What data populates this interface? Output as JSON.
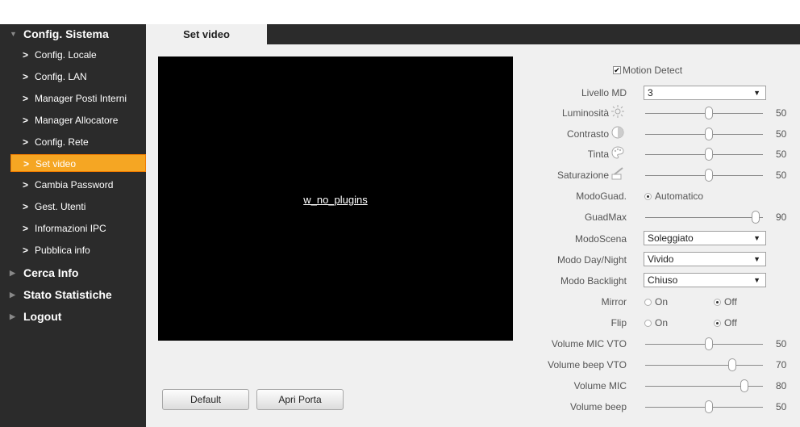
{
  "sidebar": {
    "sections": [
      {
        "label": "Config. Sistema",
        "expanded": true
      },
      {
        "label": "Cerca Info"
      },
      {
        "label": "Stato Statistiche"
      },
      {
        "label": "Logout"
      }
    ],
    "items": [
      {
        "label": "Config. Locale"
      },
      {
        "label": "Config. LAN"
      },
      {
        "label": "Manager Posti Interni"
      },
      {
        "label": "Manager Allocatore"
      },
      {
        "label": "Config. Rete"
      },
      {
        "label": "Set video",
        "active": true
      },
      {
        "label": "Cambia Password"
      },
      {
        "label": "Gest. Utenti"
      },
      {
        "label": "Informazioni IPC"
      },
      {
        "label": "Pubblica info"
      }
    ],
    "chevron": ">"
  },
  "tab": {
    "label": "Set video"
  },
  "video": {
    "link": "w_no_plugins"
  },
  "buttons": {
    "default": "Default",
    "open_door": "Apri Porta"
  },
  "settings": {
    "motion_detect": {
      "label": "Motion Detect",
      "checked": true
    },
    "md_level": {
      "label": "Livello MD",
      "value": "3"
    },
    "brightness": {
      "label": "Luminosità",
      "value": "50",
      "icon": "sun-icon"
    },
    "contrast": {
      "label": "Contrasto",
      "value": "50",
      "icon": "contrast-icon"
    },
    "hue": {
      "label": "Tinta",
      "value": "50",
      "icon": "palette-icon"
    },
    "saturation": {
      "label": "Saturazione",
      "value": "50",
      "icon": "saturation-icon"
    },
    "gain_mode": {
      "label": "ModoGuad.",
      "value": "Automatico"
    },
    "gain_max": {
      "label": "GuadMax",
      "value": "90"
    },
    "scene_mode": {
      "label": "ModoScena",
      "value": "Soleggiato"
    },
    "day_night": {
      "label": "Modo Day/Night",
      "value": "Vivido"
    },
    "backlight": {
      "label": "Modo Backlight",
      "value": "Chiuso"
    },
    "mirror": {
      "label": "Mirror",
      "on": "On",
      "off": "Off",
      "selected": "Off"
    },
    "flip": {
      "label": "Flip",
      "on": "On",
      "off": "Off",
      "selected": "Off"
    },
    "vol_mic_vto": {
      "label": "Volume MIC VTO",
      "value": "50"
    },
    "vol_beep_vto": {
      "label": "Volume beep VTO",
      "value": "70"
    },
    "vol_mic": {
      "label": "Volume MIC",
      "value": "80"
    },
    "vol_beep": {
      "label": "Volume beep",
      "value": "50"
    }
  },
  "colors": {
    "sidebar": "#2b2b2b",
    "active": "#f5a623",
    "panel": "#f0f0f0"
  }
}
